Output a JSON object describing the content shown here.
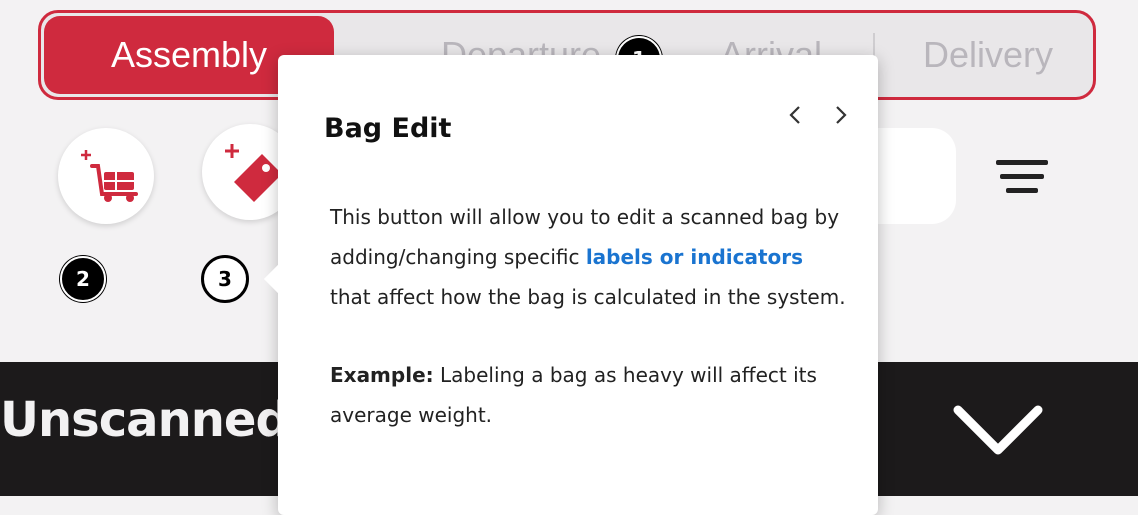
{
  "tabs": {
    "assembly": "Assembly",
    "departure": "Departure",
    "arrival": "Arrival",
    "delivery": "Delivery"
  },
  "badges": {
    "one": "1",
    "two": "2",
    "three": "3"
  },
  "section": {
    "title": "Unscanned"
  },
  "popover": {
    "title": "Bag Edit",
    "body_part1": "This button will allow you to edit a scanned bag by adding/changing specific ",
    "body_link": "labels or indicators",
    "body_part2": " that affect how the bag is calculated in the system.",
    "example_label": "Example:",
    "example_text": " Labeling a bag as heavy will affect its average weight."
  },
  "icons": {
    "add_cart": "add-cart-icon",
    "add_tag": "add-tag-icon",
    "menu": "hamburger-menu-icon",
    "prev": "chevron-left-icon",
    "next": "chevron-right-icon",
    "expand": "chevron-down-icon"
  },
  "colors": {
    "accent": "#cf2a3e",
    "link": "#1a74d0",
    "bar": "#1c1a1b"
  }
}
